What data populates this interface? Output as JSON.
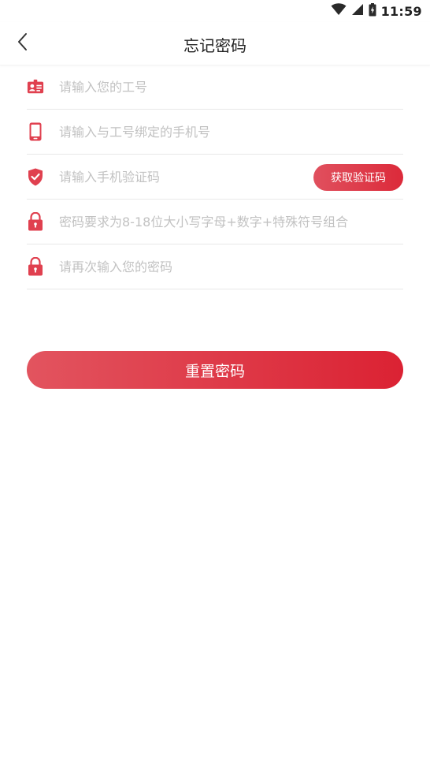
{
  "status_bar": {
    "time": "11:59",
    "icons": [
      "wifi-icon",
      "signal-icon",
      "battery-icon"
    ]
  },
  "header": {
    "title": "忘记密码",
    "back_icon": "chevron-left-icon"
  },
  "form": {
    "employee_id": {
      "placeholder": "请输入您的工号",
      "value": "",
      "icon": "id-card-icon"
    },
    "phone": {
      "placeholder": "请输入与工号绑定的手机号",
      "value": "",
      "icon": "phone-icon"
    },
    "sms_code": {
      "placeholder": "请输入手机验证码",
      "value": "",
      "icon": "shield-check-icon",
      "button_label": "获取验证码"
    },
    "new_password": {
      "placeholder": "密码要求为8-18位大小写字母+数字+特殊符号组合",
      "value": "",
      "icon": "lock-icon"
    },
    "confirm_password": {
      "placeholder": "请再次输入您的密码",
      "value": "",
      "icon": "lock-icon"
    }
  },
  "actions": {
    "reset_label": "重置密码"
  },
  "colors": {
    "accent": "#db2233",
    "accent_light": "#e2545f",
    "placeholder": "#c2c2c2",
    "divider": "#e8e8e8"
  }
}
